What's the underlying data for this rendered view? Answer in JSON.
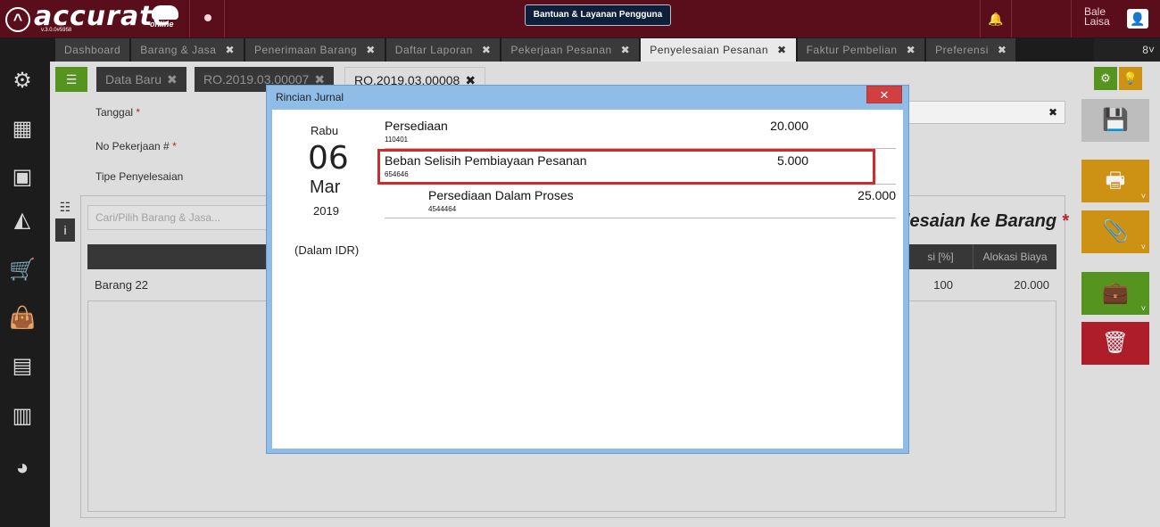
{
  "app": {
    "brand": "accurate",
    "brand_sub": "online",
    "version": "v.3.0.0#5958",
    "help_label": "Bantuan & Layanan Pengguna",
    "user_name": "Bale Laisa"
  },
  "tabs": [
    {
      "label": "Dashboard",
      "closable": false
    },
    {
      "label": "Barang & Jasa",
      "closable": true
    },
    {
      "label": "Penerimaan Barang",
      "closable": true
    },
    {
      "label": "Daftar Laporan",
      "closable": true
    },
    {
      "label": "Pekerjaan Pesanan",
      "closable": true
    },
    {
      "label": "Penyelesaian Pesanan",
      "closable": true,
      "active": true
    },
    {
      "label": "Faktur Pembelian",
      "closable": true
    },
    {
      "label": "Preferensi",
      "closable": true
    }
  ],
  "tabs_more": "8",
  "subtabs": {
    "new": "Data Baru",
    "doc1": "RO.2019.03.00007",
    "doc2": "RO.2019.03.00008"
  },
  "form": {
    "date_label": "Tanggal",
    "job_label": "No Pekerjaan #",
    "type_label": "Tipe Penyelesaian",
    "search_placeholder": "Cari/Pilih Barang & Jasa...",
    "section_title": "lesaian ke Barang",
    "table_headers": {
      "alloc_pct": "si [%]",
      "alloc_cost": "Alokasi Biaya"
    },
    "row": {
      "item": "Barang 22",
      "pct": "100",
      "cost": "20.000"
    }
  },
  "modal": {
    "title": "Rincian Jurnal",
    "day_name": "Rabu",
    "day": "06",
    "month": "Mar",
    "year": "2019",
    "currency_note": "(Dalam IDR)",
    "entries": [
      {
        "name": "Persediaan",
        "code": "110401",
        "debit": "20.000",
        "credit": ""
      },
      {
        "name": "Beban Selisih Pembiayaan Pesanan",
        "code": "654646",
        "debit": "5.000",
        "credit": ""
      },
      {
        "name": "Persediaan Dalam Proses",
        "code": "4544464",
        "debit": "",
        "credit": "25.000"
      }
    ]
  },
  "colors": {
    "topbar": "#5a0d1a",
    "accent_green": "#5b9c22",
    "accent_orange": "#d89a16",
    "danger": "#b8202d",
    "highlight": "#d22a2a"
  },
  "icons": [
    "gear-icon",
    "grid-icon",
    "book-icon",
    "wallet-icon",
    "cart-icon",
    "bag-icon",
    "calculator-icon",
    "building-icon",
    "pie-icon",
    "save-icon",
    "print-icon",
    "paperclip-icon",
    "briefcase-icon",
    "trash-icon",
    "bell-icon",
    "user-icon",
    "list-icon",
    "info-icon"
  ]
}
